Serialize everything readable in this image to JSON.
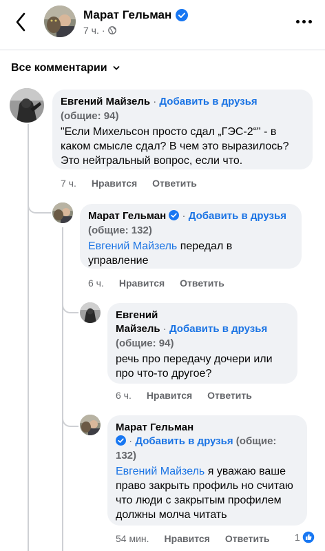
{
  "header": {
    "name": "Марат Гельман",
    "time": "7 ч.",
    "separator": "·"
  },
  "filter": {
    "label": "Все комментарии"
  },
  "comments": [
    {
      "author": "Евгений Майзель",
      "separator": "·",
      "add_friend": "Добавить в друзья",
      "mutual": "(общие: 94)",
      "text": "\"Если Михельсон просто сдал „ГЭС-2“\" - в каком смысле сдал? В чем это выразилось? Это нейтральный вопрос, если что.",
      "time": "7 ч.",
      "like": "Нравится",
      "reply": "Ответить"
    },
    {
      "author": "Марат Гельман",
      "separator": "·",
      "add_friend": "Добавить в друзья",
      "mutual": "(общие: 132)",
      "mention": "Евгений Майзель",
      "text": "передал в управление",
      "time": "6 ч.",
      "like": "Нравится",
      "reply": "Ответить"
    },
    {
      "author_line1": "Евгений",
      "author_line2": "Майзель",
      "separator": "·",
      "add_friend": "Добавить в друзья",
      "mutual": "(общие: 94)",
      "text": "речь про передачу дочери или про что-то другое?",
      "time": "6 ч.",
      "like": "Нравится",
      "reply": "Ответить"
    },
    {
      "author": "Марат Гельман",
      "separator": "·",
      "add_friend": "Добавить в друзья",
      "mutual": "(общие:",
      "mutual_count": "132)",
      "mention": "Евгений Майзель",
      "text": "я уважаю ваше право закрыть профиль но считаю что люди с закрытым профилем должны молча читать",
      "time": "54 мин.",
      "like": "Нравится",
      "reply": "Ответить",
      "reaction_count": "1"
    }
  ],
  "colors": {
    "link": "#1b74e4",
    "bubble": "#f0f2f5",
    "muted": "#65676b",
    "verified": "#1877f2"
  },
  "icons": {
    "back": "chevron-left-icon",
    "more": "more-horizontal-icon",
    "globe": "globe-icon",
    "verified": "verified-badge-icon",
    "dropdown": "chevron-down-icon",
    "reaction": "like-reaction-icon"
  }
}
